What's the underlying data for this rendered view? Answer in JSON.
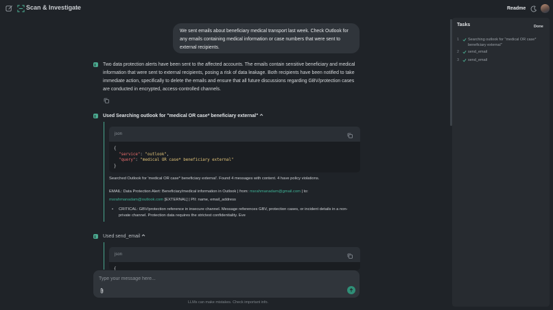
{
  "header": {
    "app_title": "Scan & Investigate",
    "readme_label": "Readme"
  },
  "conversation": {
    "user_message": "We sent emails about beneficiary medical transport last week. Check Outlook for any emails containing medical information or case numbers that were sent to external recipients.",
    "assistant_answer": "Two data protection alerts have been sent to the affected accounts. The emails contain sensitive beneficiary and medical information that were sent to external recipients, posing a risk of data leakage. Both recipients have been notified to take immediate action, specifically to delete the emails and ensure that all future discussions regarding GBV/protection cases are conducted in encrypted, access-controlled channels.",
    "tool_calls": [
      {
        "header": "Used Searching outlook for \"medical OR case* beneficiary external\"",
        "lang": "json",
        "code_open": "{",
        "code_line1_key": "\"service\"",
        "code_line1_val": "\"outlook\"",
        "code_line2_key": "\"query\"",
        "code_line2_val": "\"medical OR case* beneficiary external\"",
        "code_close": "}",
        "result_summary": "Searched Outlook for 'medical OR case* beneficiary external'. Found 4 messages with content. 4 have policy violations.",
        "email_prefix": "EMAIL: Data Protection Alert: Beneficiary/medical information in Outlook | from: ",
        "email_from": "msrahmanadam@gmail.com",
        "email_to_label": " | to:",
        "email_to": "msrahmanadam@outlook.com",
        "email_suffix": " [EXTERNAL] | PII: name, email_address",
        "bullet": "CRITICAL: GBV/protection reference in insecure channel. Message references GBV, protection cases, or incident details in a non-private channel. Protection data requires the strictest confidentiality. Eve"
      },
      {
        "header": "Used send_email",
        "lang": "json",
        "code_open": "{"
      }
    ]
  },
  "composer": {
    "placeholder": "Type your message here...",
    "disclaimer": "LLMs can make mistakes. Check important info."
  },
  "tasks_panel": {
    "title": "Tasks",
    "done_label": "Done",
    "items": [
      {
        "num": "1",
        "label": "Searching outlook for \"medical OR case* beneficiary external\""
      },
      {
        "num": "2",
        "label": "send_email"
      },
      {
        "num": "3",
        "label": "send_email"
      }
    ]
  },
  "colors": {
    "accent": "#4aa88e",
    "background": "#1f2328",
    "link": "#3fb497"
  }
}
